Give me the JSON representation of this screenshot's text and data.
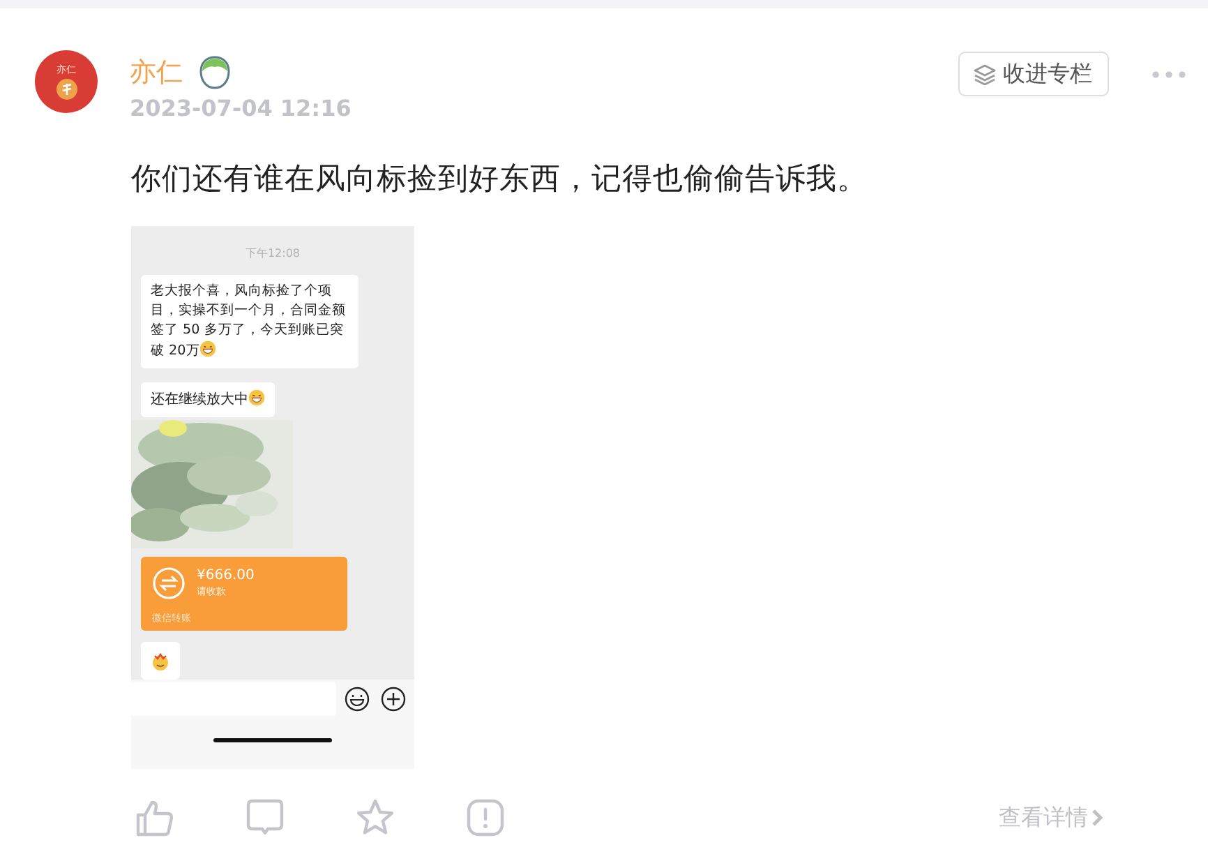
{
  "author": {
    "name": "亦仁",
    "avatar_text": "亦仁",
    "time": "2023-07-04 12:16"
  },
  "collect_button": "收进专栏",
  "post_text": "你们还有谁在风向标捡到好东西，记得也偷偷告诉我。",
  "chat": {
    "timestamp": "下午12:08",
    "messages": [
      {
        "kind": "text",
        "text": "老大报个喜，风向标捡了个项目，实操不到一个月，合同金额签了 50 多万了，今天到账已突破 20万",
        "emoji": true
      },
      {
        "kind": "text",
        "text": "还在继续放大中",
        "emoji": true
      },
      {
        "kind": "picture"
      },
      {
        "kind": "transfer",
        "amount": "¥666.00",
        "note": "请收款",
        "footer": "微信转账"
      },
      {
        "kind": "sticker"
      }
    ]
  },
  "view_details": "查看详情"
}
